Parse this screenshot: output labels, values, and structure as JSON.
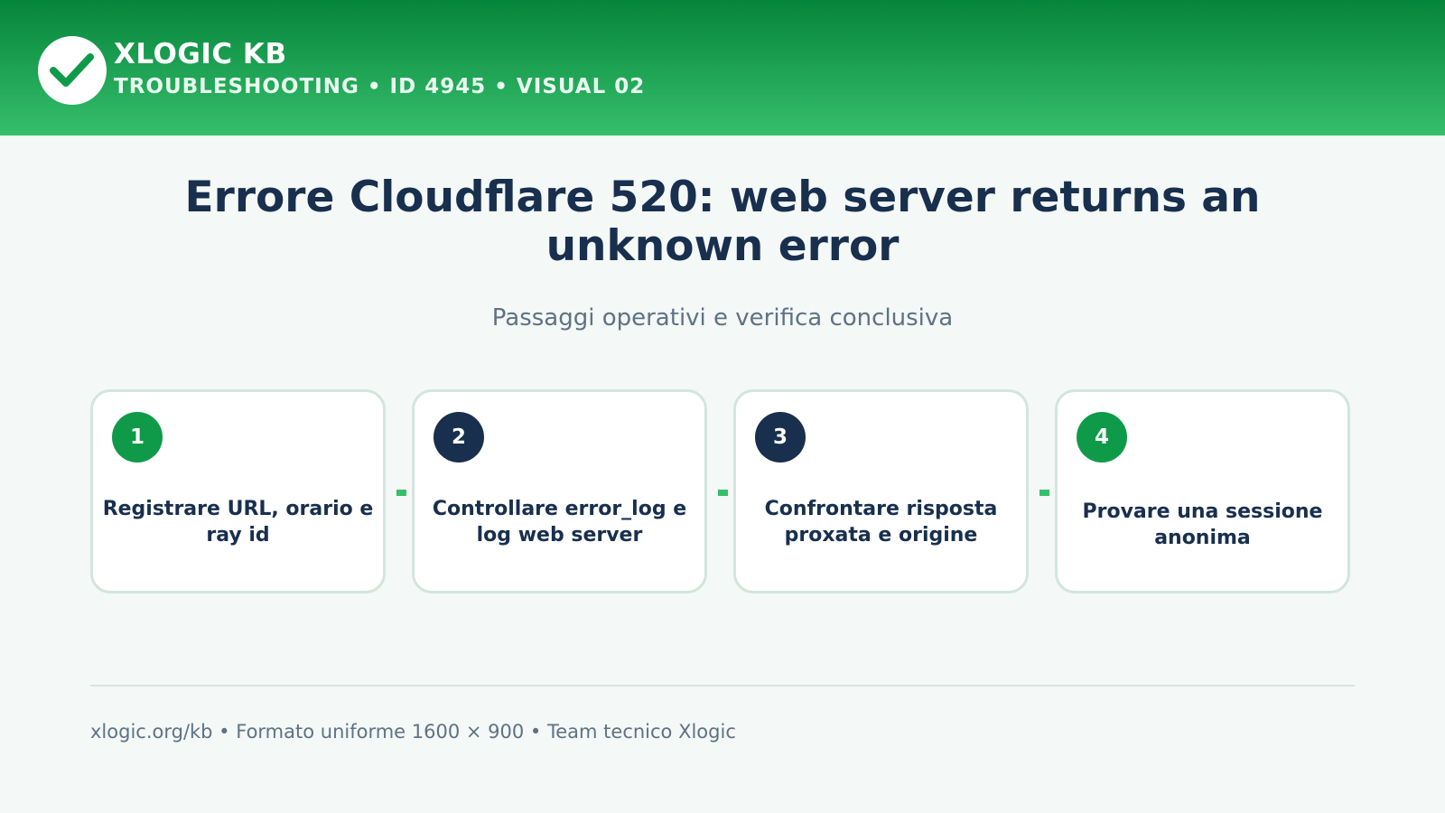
{
  "header": {
    "brand": "XLOGIC KB",
    "breadcrumb": "TROUBLESHOOTING • ID 4945 • VISUAL 02",
    "logo_icon": "checkmark-icon"
  },
  "main": {
    "title": "Errore Cloudflare 520: web server returns an unknown error",
    "subtitle": "Passaggi operativi e verifica conclusiva",
    "steps": [
      {
        "number": "1",
        "text": "Registrare URL, orario e ray id",
        "color": "#0f9a4a"
      },
      {
        "number": "2",
        "text": "Controllare error_log e log web server",
        "color": "#182f4e"
      },
      {
        "number": "3",
        "text": "Confrontare risposta proxata e origine",
        "color": "#182f4e"
      },
      {
        "number": "4",
        "text": "Provare una sessione anonima",
        "color": "#0f9a4a"
      }
    ]
  },
  "footer": {
    "text": "xlogic.org/kb • Formato uniforme 1600 × 900 • Team tecnico Xlogic"
  },
  "colors": {
    "header_dark": "#06843b",
    "header_light": "#35bf6b",
    "text_dark": "#182f4e",
    "text_muted": "#5e7285",
    "accent_green": "#0f9a4a"
  }
}
